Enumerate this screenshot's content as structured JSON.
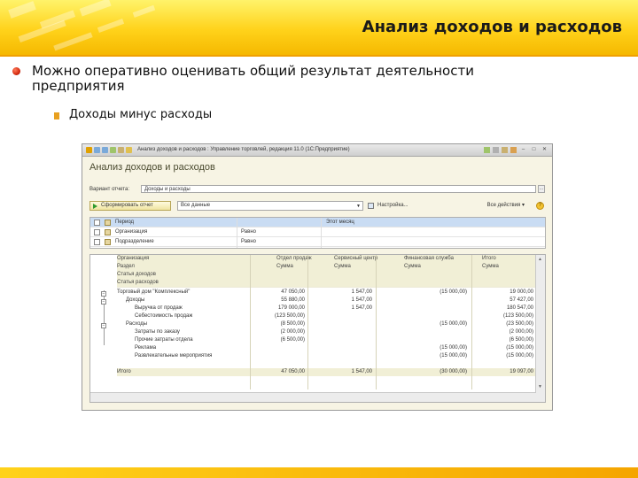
{
  "slide": {
    "title": "Анализ доходов и расходов",
    "bullet1": "Можно оперативно оценивать общий результат деятельности предприятия",
    "bullet2": "Доходы минус расходы",
    "colors": {
      "header_top": "#fff36a",
      "header_bottom": "#f5b800",
      "bullet_red": "#d42b10",
      "bullet_orange": "#e8a020"
    }
  },
  "window": {
    "title": "Анализ доходов и расходов : Управление торговлей, редакция 11.0 (1С:Предприятие)",
    "form_title": "Анализ доходов и расходов",
    "variant_label": "Вариант отчета:",
    "variant_value": "Доходы и расходы",
    "variant_button": "...",
    "generate_button": "Сформировать отчет",
    "period_select": "Все данные",
    "settings_button": "Настройка...",
    "more_button": "Все действия ▾",
    "help_button": "?"
  },
  "filters": {
    "rows": [
      {
        "field": "Период",
        "condition": "",
        "value": "Этот месяц"
      },
      {
        "field": "Организация",
        "condition": "Равно",
        "value": ""
      },
      {
        "field": "Подразделение",
        "condition": "Равно",
        "value": ""
      }
    ]
  },
  "report": {
    "headers": {
      "group1": "Организация",
      "group2": "Раздел",
      "group3": "Статья доходов",
      "group4": "Статья расходов",
      "col1_top": "Отдел продаж",
      "col1_bottom": "Сумма",
      "col2_top": "Сервисный центр",
      "col2_bottom": "Сумма",
      "col3_top": "Финансовая служба",
      "col3_bottom": "Сумма",
      "col4_top": "Итого",
      "col4_bottom": "Сумма"
    },
    "rows": [
      {
        "label": "Торговый дом \"Комплексный\"",
        "c1": "47 050,00",
        "c2": "1 547,00",
        "c3": "(15 000,00)",
        "c4": "19 000,00"
      },
      {
        "label": "Доходы",
        "c1": "55 880,00",
        "c2": "1 547,00",
        "c3": "",
        "c4": "57 427,00"
      },
      {
        "label": "Выручка от продаж",
        "c1": "179 000,00",
        "c2": "1 547,00",
        "c3": "",
        "c4": "180 547,00"
      },
      {
        "label": "Себестоимость продаж",
        "c1": "(123 500,00)",
        "c2": "",
        "c3": "",
        "c4": "(123 500,00)"
      },
      {
        "label": "Расходы",
        "c1": "(8 500,00)",
        "c2": "",
        "c3": "(15 000,00)",
        "c4": "(23 500,00)"
      },
      {
        "label": "Затраты по заказу",
        "c1": "(2 000,00)",
        "c2": "",
        "c3": "",
        "c4": "(2 000,00)"
      },
      {
        "label": "Прочие затраты отдела",
        "c1": "(6 500,00)",
        "c2": "",
        "c3": "",
        "c4": "(6 500,00)"
      },
      {
        "label": "Реклама",
        "c1": "",
        "c2": "",
        "c3": "(15 000,00)",
        "c4": "(15 000,00)"
      },
      {
        "label": "Развлекательные мероприятия",
        "c1": "",
        "c2": "",
        "c3": "(15 000,00)",
        "c4": "(15 000,00)"
      }
    ],
    "total": {
      "label": "Итого",
      "c1": "47 050,00",
      "c2": "1 547,00",
      "c3": "(30 000,00)",
      "c4": "19 097,00"
    }
  }
}
